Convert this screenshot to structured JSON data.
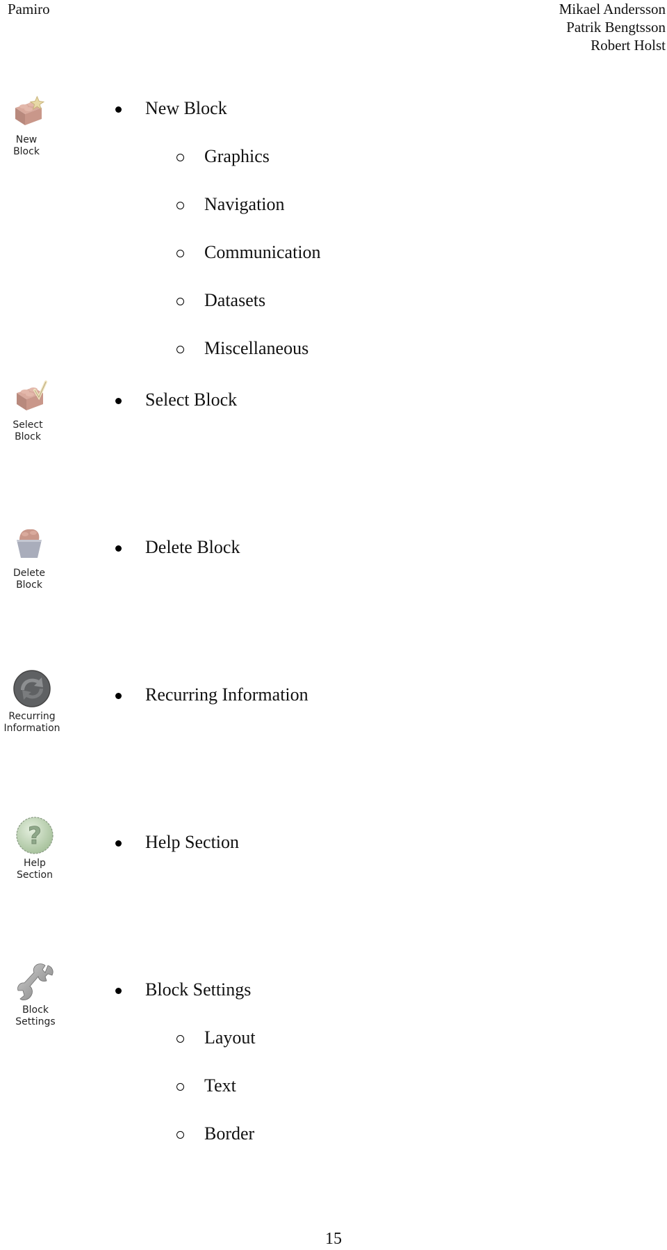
{
  "header": {
    "left": "Pamiro",
    "authors": [
      "Mikael Andersson",
      "Patrik Bengtsson",
      "Robert Holst"
    ]
  },
  "items": [
    {
      "icon": "new-block-icon",
      "icon_caption": [
        "New",
        "Block"
      ],
      "label": "New Block",
      "subitems": [
        "Graphics",
        "Navigation",
        "Communication",
        "Datasets",
        "Miscellaneous"
      ]
    },
    {
      "icon": "select-block-icon",
      "icon_caption": [
        "Select",
        "Block"
      ],
      "label": "Select Block",
      "subitems": []
    },
    {
      "icon": "delete-block-icon",
      "icon_caption": [
        "Delete",
        "Block"
      ],
      "label": "Delete Block",
      "subitems": []
    },
    {
      "icon": "recurring-information-icon",
      "icon_caption": [
        "Recurring",
        "Information"
      ],
      "label": "Recurring Information",
      "subitems": []
    },
    {
      "icon": "help-section-icon",
      "icon_caption": [
        "Help",
        "Section"
      ],
      "label": "Help Section",
      "subitems": []
    },
    {
      "icon": "block-settings-icon",
      "icon_caption": [
        "Block",
        "Settings"
      ],
      "label": "Block Settings",
      "subitems": [
        "Layout",
        "Text",
        "Border"
      ]
    }
  ],
  "footer": {
    "page_number": "15"
  },
  "colors": {
    "block": "#c9978a",
    "star": "#e8d9a6",
    "bucket": "#a9adbb",
    "recurring": "#6b6d6f",
    "help": "#b9cfb0",
    "wrench": "#9a9a9a"
  }
}
